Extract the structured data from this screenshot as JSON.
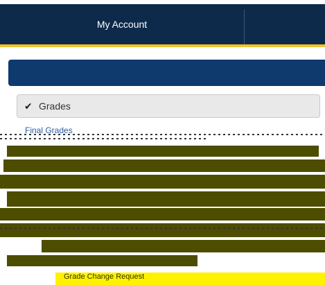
{
  "nav": {
    "account_label": "My Account"
  },
  "grades": {
    "label": "Grades",
    "check_icon": "✔"
  },
  "menu": {
    "first_item": "Final Grades",
    "footer_item": "Grade Change Request"
  },
  "colors": {
    "nav_bg": "#0e2a4b",
    "accent": "#f2c12e",
    "panel": "#0e3a6d",
    "olive": "#4d4d00",
    "highlight": "#fff200"
  }
}
